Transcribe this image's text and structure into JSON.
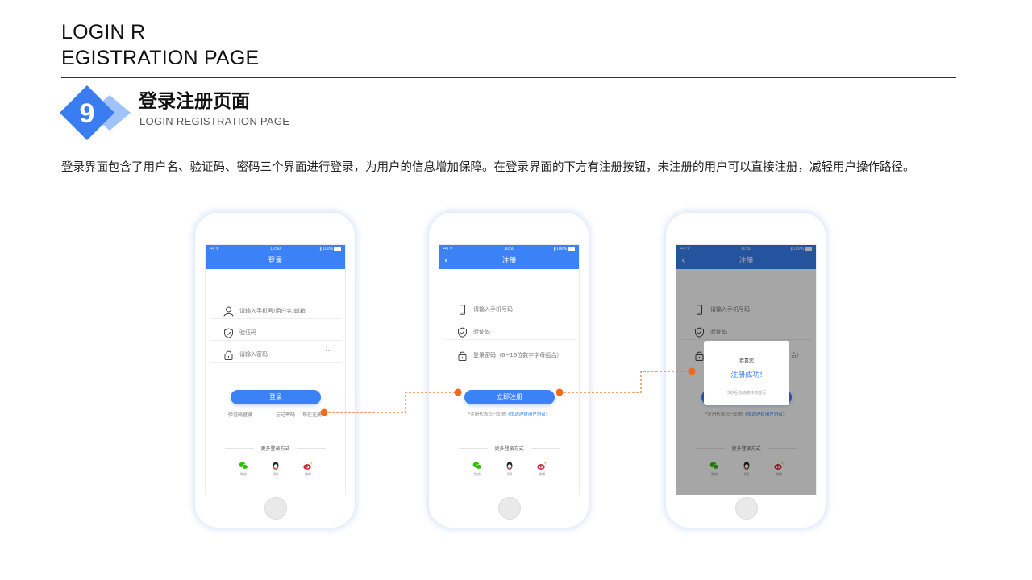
{
  "header": {
    "title_line1": "LOGIN R",
    "title_line2": "EGISTRATION PAGE"
  },
  "section": {
    "number": "9",
    "title_cn": "登录注册页面",
    "title_en": "LOGIN REGISTRATION PAGE",
    "description": "登录界面包含了用户名、验证码、密码三个界面进行登录，为用户的信息增加保障。在登录界面的下方有注册按钮，未注册的用户可以直接注册，减轻用户操作路径。"
  },
  "colors": {
    "accent": "#3a82f5",
    "connector": "#f06a1e",
    "badge": "#3a7df0"
  },
  "status_bar": {
    "signal": "••ıl ᯤ",
    "time": "10:50",
    "battery": "∦ 100%"
  },
  "login_screen": {
    "nav_title": "登录",
    "username_placeholder": "请输入手机号/用户名/邮箱",
    "code_placeholder": "验证码",
    "password_placeholder": "请输入密码",
    "eye_glyph": "ˋˋˋ",
    "login_button": "登录",
    "sms_login_link": "验证码登录",
    "forgot_link": "忘记密码",
    "register_link": "现在注册",
    "more_login": "更多登录方式",
    "social": {
      "wechat": "微信",
      "qq": "QQ",
      "weibo": "微博"
    }
  },
  "register_screen": {
    "nav_title": "注册",
    "back_icon": "‹",
    "phone_placeholder": "请输入手机号码",
    "code_placeholder": "验证码",
    "password_placeholder": "登录密码（6~16位数字字母组合）",
    "register_button": "立即注册",
    "agreement_prefix": "*注册代表您已同意",
    "agreement_link": "《优选理财用户协议》",
    "more_login": "更多登录方式",
    "social": {
      "wechat": "微信",
      "qq": "QQ",
      "weibo": "微博"
    }
  },
  "success_screen": {
    "nav_title": "注册",
    "back_icon": "‹",
    "phone_placeholder": "请输入手机号码",
    "code_placeholder": "验证码",
    "password_visible_fragment": "合）",
    "dialog_greeting": "恭喜您",
    "dialog_message": "注册成功!",
    "dialog_note": "3秒后自动跳转到首页",
    "agreement_prefix": "*注册代表您已同意",
    "agreement_link": "《优选理财用户协议》",
    "more_login": "更多登录方式",
    "social": {
      "wechat": "微信",
      "qq": "QQ",
      "weibo": "微博"
    }
  }
}
